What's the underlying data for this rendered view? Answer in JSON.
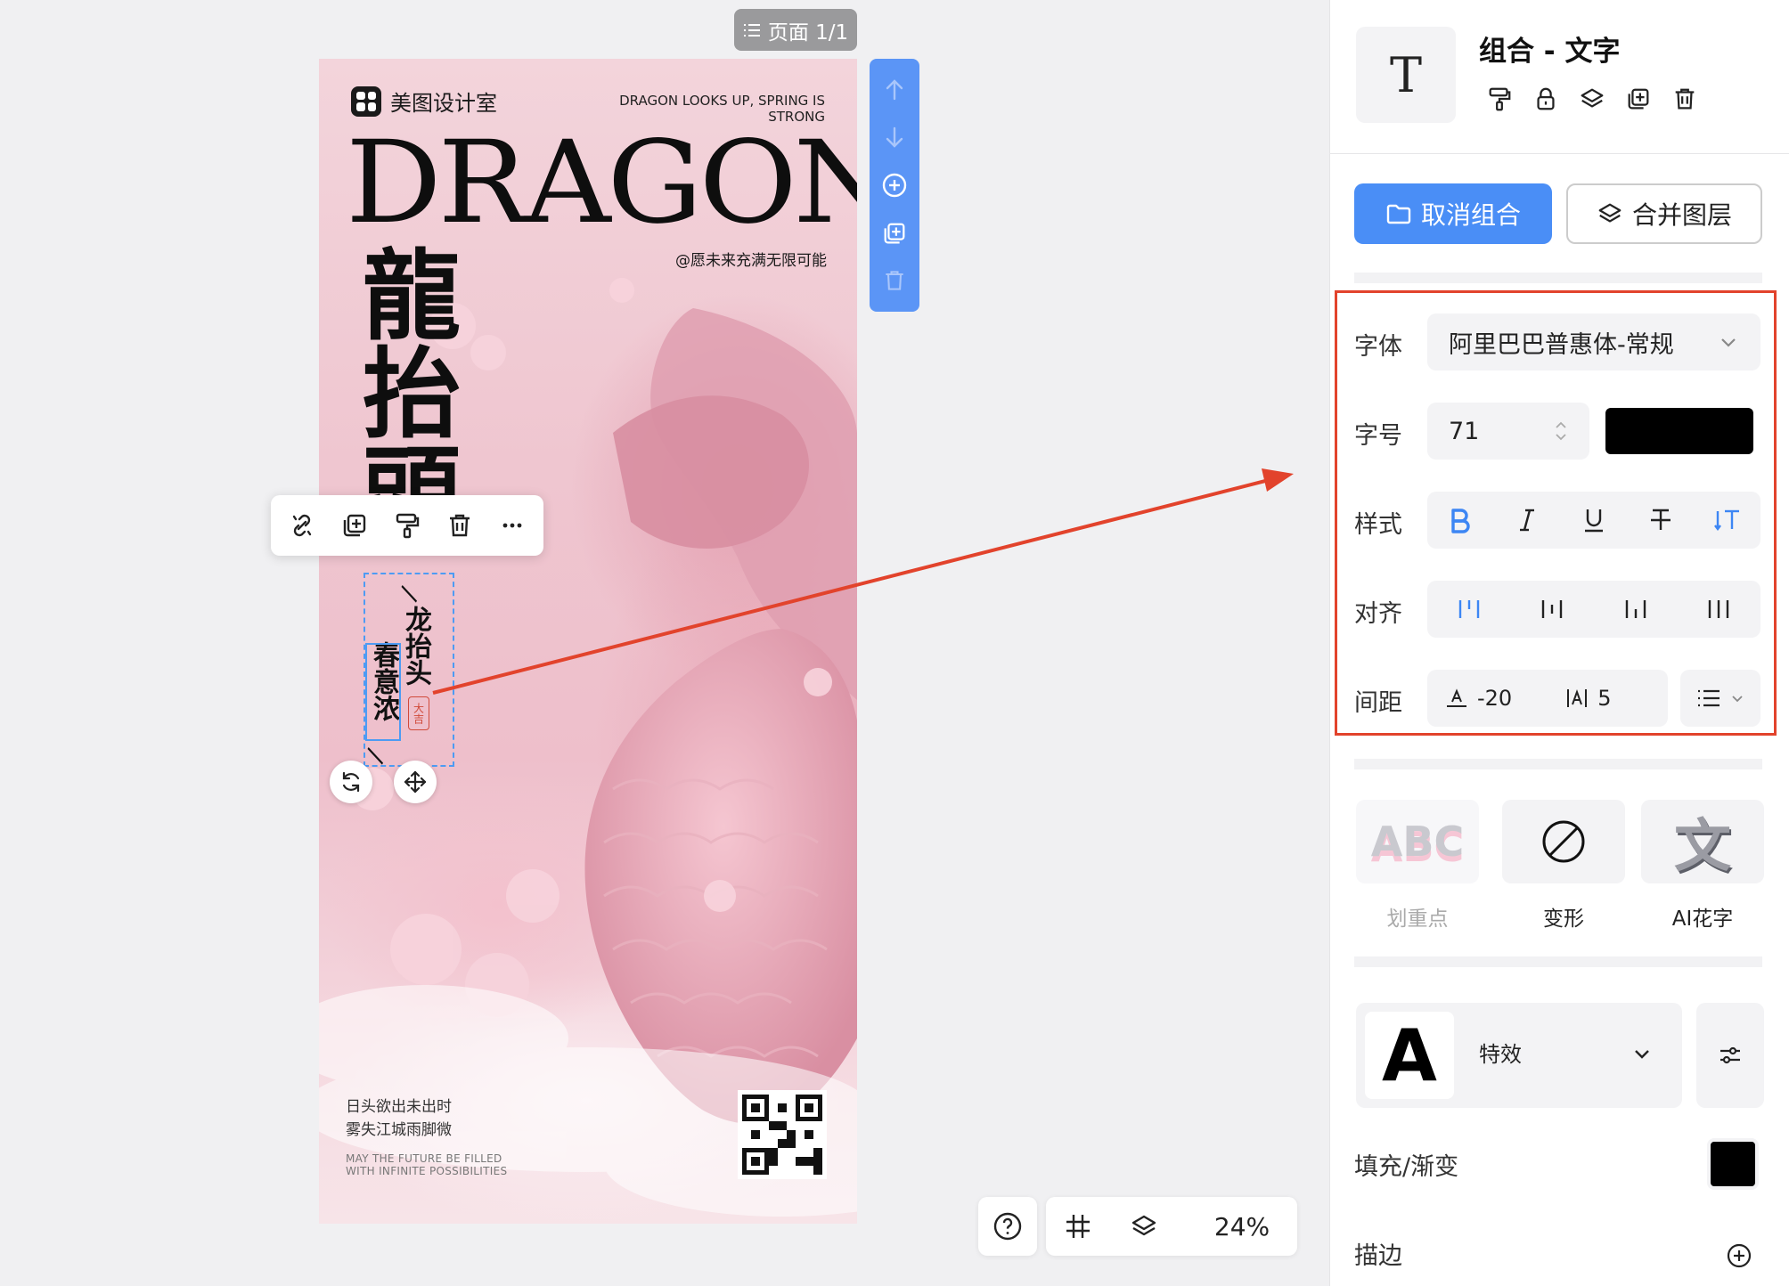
{
  "page_indicator": {
    "label": "页面 1/1"
  },
  "poster": {
    "brand": "美图设计室",
    "tagline_en": "DRAGON LOOKS UP, SPRING IS STRONG",
    "title_en": "DRAGON",
    "subtitle_cn": "@愿未来充满无限可能",
    "title_cn": "龍抬頭",
    "poem_col1": "龙抬头",
    "poem_col2": "春意浓",
    "seal_text": "大吉",
    "footer_cn_line1": "日头欲出未出时",
    "footer_cn_line2": "雾失江城雨脚微",
    "footer_en": "MAY THE FUTURE BE FILLED WITH INFINITE POSSIBILITIES"
  },
  "bottom_bar": {
    "zoom": "24%"
  },
  "panel": {
    "title": "组合 - 文字",
    "ungroup_label": "取消组合",
    "merge_label": "合并图层",
    "font_label": "字体",
    "font_value": "阿里巴巴普惠体-常规",
    "size_label": "字号",
    "size_value": "71",
    "text_color": "#000000",
    "style_label": "样式",
    "align_label": "对齐",
    "spacing_label": "间距",
    "letter_spacing": "-20",
    "line_spacing": "5",
    "cards": [
      {
        "label": "划重点",
        "preview": "ABC"
      },
      {
        "label": "变形"
      },
      {
        "label": "AI花字",
        "preview": "文"
      }
    ],
    "effect_preview": "A",
    "effect_label": "特效",
    "fill_label": "填充/渐变",
    "fill_color": "#000000",
    "stroke_label": "描边"
  },
  "colors": {
    "accent": "#4a8ef6",
    "highlight": "#e2432c",
    "arrow": "#e2432c"
  }
}
